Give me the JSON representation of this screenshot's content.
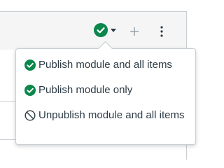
{
  "module": {
    "publish_status": "check-circle-icon",
    "status_color": "#0b874b"
  },
  "toolbar": {
    "publish_caret_icon": "caret-down-icon",
    "add_icon": "plus-icon",
    "more_icon": "kebab-icon"
  },
  "publish_menu": {
    "items": [
      {
        "label": "Publish module and all items",
        "icon": "check-circle-icon"
      },
      {
        "label": "Publish module only",
        "icon": "check-circle-icon"
      },
      {
        "label": "Unpublish module and all items",
        "icon": "no-entry-icon"
      }
    ]
  }
}
